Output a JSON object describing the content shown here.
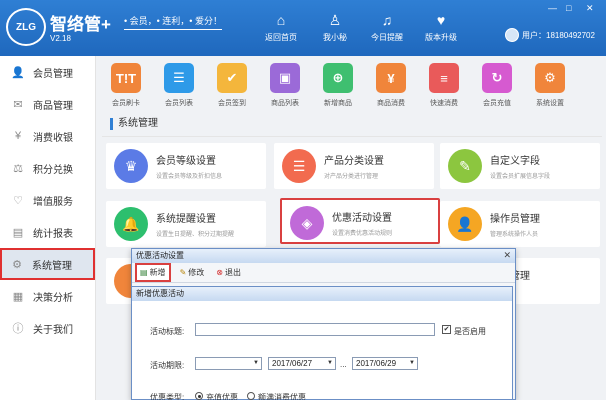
{
  "header": {
    "logo_text": "ZLG",
    "brand": "智络管+",
    "version": "V2.18",
    "slogan": "• 会员，• 连利，• 爱分！",
    "nav": [
      {
        "label": "返回首页",
        "icon": "home-icon"
      },
      {
        "label": "我小秘",
        "icon": "person-icon"
      },
      {
        "label": "今日提醒",
        "icon": "bell-icon"
      },
      {
        "label": "版本升级",
        "icon": "upgrade-icon"
      }
    ],
    "user": "用户：18180492702"
  },
  "sidebar": {
    "items": [
      {
        "label": "会员管理",
        "icon": "member-icon"
      },
      {
        "label": "商品管理",
        "icon": "goods-icon"
      },
      {
        "label": "消费收银",
        "icon": "cashier-icon"
      },
      {
        "label": "积分兑换",
        "icon": "points-icon"
      },
      {
        "label": "增值服务",
        "icon": "heart-icon"
      },
      {
        "label": "统计报表",
        "icon": "report-icon"
      },
      {
        "label": "系统管理",
        "icon": "gear-icon"
      },
      {
        "label": "决策分析",
        "icon": "analysis-icon"
      },
      {
        "label": "关于我们",
        "icon": "info-icon"
      }
    ],
    "active_index": 6
  },
  "quick_icons": [
    {
      "label": "会员刷卡",
      "color": "#f0853b",
      "glyph": "T!T"
    },
    {
      "label": "会员列表",
      "color": "#2e9ae8",
      "glyph": "☰"
    },
    {
      "label": "会员签到",
      "color": "#f4b63c",
      "glyph": "✔"
    },
    {
      "label": "商品列表",
      "color": "#9b6ad8",
      "glyph": "▣"
    },
    {
      "label": "新增商品",
      "color": "#3fbf70",
      "glyph": "⊕"
    },
    {
      "label": "商品消费",
      "color": "#f0853b",
      "glyph": "¥"
    },
    {
      "label": "快速消费",
      "color": "#e95a5a",
      "glyph": "≡"
    },
    {
      "label": "会员充值",
      "color": "#d65ad0",
      "glyph": "↻"
    },
    {
      "label": "系统设置",
      "color": "#f0853b",
      "glyph": "⚙"
    }
  ],
  "section_title": "系统管理",
  "cards": [
    {
      "title": "会员等级设置",
      "desc": "设置会员等级及折扣信息",
      "color": "#5b7be6",
      "glyph": "♛"
    },
    {
      "title": "产品分类设置",
      "desc": "对产品分类进行管理",
      "color": "#f26b4f",
      "glyph": "☰"
    },
    {
      "title": "自定义字段",
      "desc": "设置会员扩展信息字段",
      "color": "#8cc63f",
      "glyph": "✎"
    },
    {
      "title": "系统提醒设置",
      "desc": "设置生日提醒、积分过期提醒",
      "color": "#2dbf6e",
      "glyph": "🔔"
    },
    {
      "title": "优惠活动设置",
      "desc": "设置消费优惠活动规则",
      "color": "#c06ad8",
      "glyph": "◈"
    },
    {
      "title": "操作员管理",
      "desc": "管理系统操作人员",
      "color": "#f5a623",
      "glyph": "👤"
    },
    {
      "title": "员工管理",
      "desc": "",
      "color": "#2dbf6e",
      "glyph": "👥"
    }
  ],
  "dialog1": {
    "title": "优惠活动设置",
    "buttons": [
      {
        "label": "新增",
        "icon": "add-icon"
      },
      {
        "label": "修改",
        "icon": "edit-icon"
      },
      {
        "label": "退出",
        "icon": "exit-icon"
      }
    ]
  },
  "dialog2": {
    "title": "新增优惠活动",
    "fields": {
      "name_label": "活动标题:",
      "enable_label": "是否启用",
      "enable_checked": "✔",
      "date_label": "活动期限:",
      "date_start": "2017/06/27",
      "date_sep": "...",
      "date_end": "2017/06/29",
      "type_label": "优惠类型:",
      "type_option1": "充值优惠",
      "type_option2": "额满消费优惠"
    }
  }
}
